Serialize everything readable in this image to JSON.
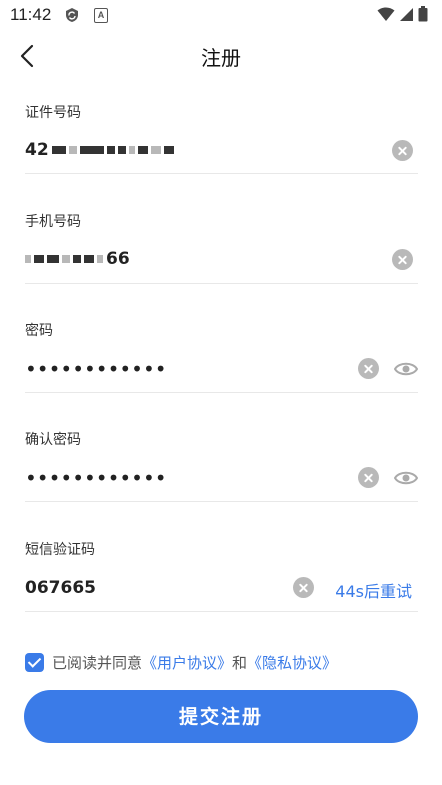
{
  "status_bar": {
    "time": "11:42",
    "app_icon_letter": "A"
  },
  "header": {
    "title": "注册"
  },
  "fields": {
    "id_number": {
      "label": "证件号码",
      "value_prefix": "42"
    },
    "phone": {
      "label": "手机号码",
      "value_suffix": "66"
    },
    "password": {
      "label": "密码",
      "value": "••••••••••••"
    },
    "confirm_password": {
      "label": "确认密码",
      "value": "••••••••••••"
    },
    "sms_code": {
      "label": "短信验证码",
      "value": "067665",
      "resend_label": "44s后重试"
    }
  },
  "agreement": {
    "checked": true,
    "prefix": "已阅读并同意",
    "user_agreement": "《用户协议》",
    "conjunction": "和",
    "privacy_agreement": "《隐私协议》"
  },
  "submit_label": "提交注册",
  "colors": {
    "accent": "#3a7be8",
    "clear_icon": "#b9b9b9"
  }
}
